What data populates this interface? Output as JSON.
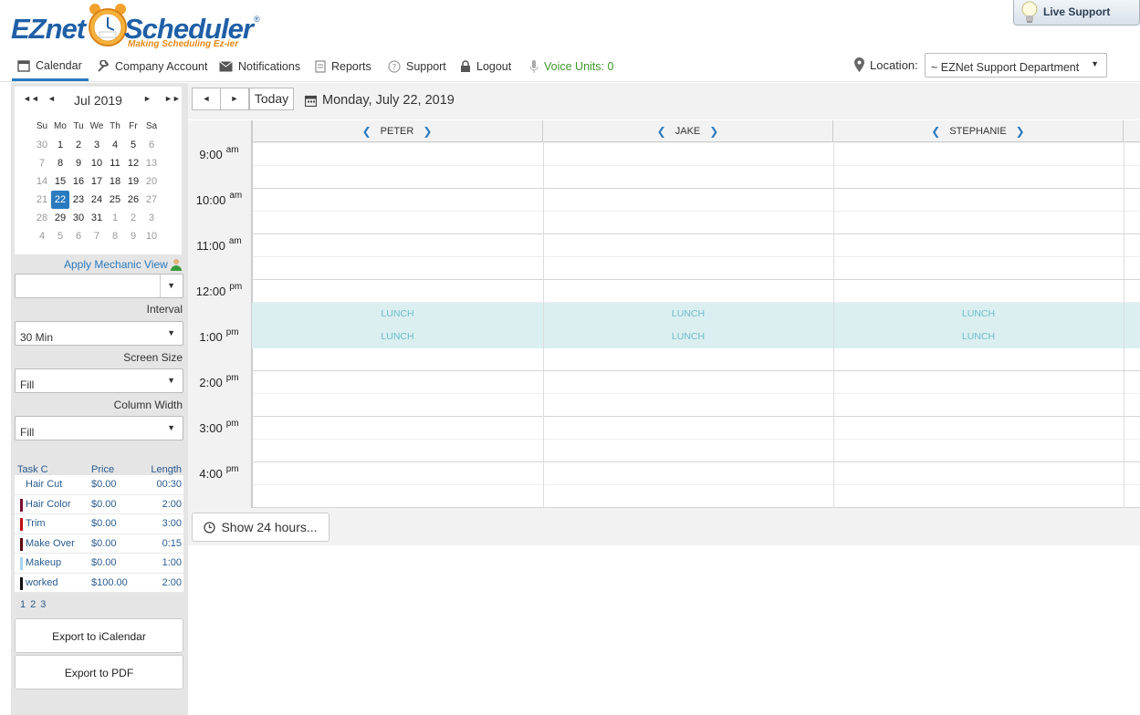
{
  "header": {
    "logo_ez": "EZnet",
    "logo_scheduler": "Scheduler",
    "logo_reg": "®",
    "logo_tagline": "Making Scheduling Ez-ier",
    "live_support": "Live Support"
  },
  "nav": {
    "items": [
      {
        "label": "Calendar",
        "icon": "calendar-icon",
        "active": true
      },
      {
        "label": "Company Account",
        "icon": "wrench-icon"
      },
      {
        "label": "Notifications",
        "icon": "envelope-icon"
      },
      {
        "label": "Reports",
        "icon": "document-icon"
      },
      {
        "label": "Support",
        "icon": "question-icon"
      },
      {
        "label": "Logout",
        "icon": "lock-icon"
      },
      {
        "label": "Voice Units: 0",
        "icon": "microphone-icon"
      }
    ],
    "location_label": "Location:",
    "location_value": "~ EZNet Support Department"
  },
  "mini_calendar": {
    "title": "Jul 2019",
    "dow": [
      "Su",
      "Mo",
      "Tu",
      "We",
      "Th",
      "Fr",
      "Sa"
    ],
    "weeks": [
      [
        [
          "30",
          1
        ],
        [
          "1",
          0
        ],
        [
          "2",
          0
        ],
        [
          "3",
          0
        ],
        [
          "4",
          0
        ],
        [
          "5",
          0
        ],
        [
          "6",
          1
        ]
      ],
      [
        [
          "7",
          1
        ],
        [
          "8",
          0
        ],
        [
          "9",
          0
        ],
        [
          "10",
          0
        ],
        [
          "11",
          0
        ],
        [
          "12",
          0
        ],
        [
          "13",
          1
        ]
      ],
      [
        [
          "14",
          1
        ],
        [
          "15",
          0
        ],
        [
          "16",
          0
        ],
        [
          "17",
          0
        ],
        [
          "18",
          0
        ],
        [
          "19",
          0
        ],
        [
          "20",
          1
        ]
      ],
      [
        [
          "21",
          1
        ],
        [
          "22",
          2
        ],
        [
          "23",
          0
        ],
        [
          "24",
          0
        ],
        [
          "25",
          0
        ],
        [
          "26",
          0
        ],
        [
          "27",
          1
        ]
      ],
      [
        [
          "28",
          1
        ],
        [
          "29",
          0
        ],
        [
          "30",
          0
        ],
        [
          "31",
          0
        ],
        [
          "1",
          1
        ],
        [
          "2",
          1
        ],
        [
          "3",
          1
        ]
      ],
      [
        [
          "4",
          1
        ],
        [
          "5",
          1
        ],
        [
          "6",
          1
        ],
        [
          "7",
          1
        ],
        [
          "8",
          1
        ],
        [
          "9",
          1
        ],
        [
          "10",
          1
        ]
      ]
    ]
  },
  "sidebar": {
    "apply_mechanic_view": "Apply Mechanic View",
    "mechanic_select_value": "",
    "interval_label": "Interval",
    "interval_value": "30 Min",
    "screen_size_label": "Screen Size",
    "screen_size_value": "Fill",
    "column_width_label": "Column Width",
    "column_width_value": "Fill",
    "task_headers": {
      "name": "Task C",
      "price": "Price",
      "length": "Length"
    },
    "tasks": [
      {
        "name": "Hair Cut",
        "price": "$0.00",
        "length": "00:30",
        "color": "#ffffff"
      },
      {
        "name": "Hair Color",
        "price": "$0.00",
        "length": "2:00",
        "color": "#7a1030"
      },
      {
        "name": "Trim",
        "price": "$0.00",
        "length": "3:00",
        "color": "#c0101a"
      },
      {
        "name": "Make Over",
        "price": "$0.00",
        "length": "0:15",
        "color": "#5a0a10"
      },
      {
        "name": "Makeup",
        "price": "$0.00",
        "length": "1:00",
        "color": "#a8d2ef"
      },
      {
        "name": "worked",
        "price": "$100.00",
        "length": "2:00",
        "color": "#111111"
      }
    ],
    "pages": [
      "1",
      "2",
      "3"
    ],
    "export_ical": "Export to iCalendar",
    "export_pdf": "Export to PDF"
  },
  "toolbar": {
    "prev": "◄",
    "next": "►",
    "today": "Today",
    "date": "Monday, July 22, 2019"
  },
  "schedule": {
    "columns": [
      "PETER",
      "JAKE",
      "STEPHANIE"
    ],
    "hours": [
      {
        "time": "9:00",
        "ampm": "am"
      },
      {
        "time": "10:00",
        "ampm": "am"
      },
      {
        "time": "11:00",
        "ampm": "am"
      },
      {
        "time": "12:00",
        "ampm": "pm"
      },
      {
        "time": "1:00",
        "ampm": "pm"
      },
      {
        "time": "2:00",
        "ampm": "pm"
      },
      {
        "time": "3:00",
        "ampm": "pm"
      },
      {
        "time": "4:00",
        "ampm": "pm"
      }
    ],
    "lunch_label": "LUNCH",
    "show24": "Show 24 hours..."
  }
}
